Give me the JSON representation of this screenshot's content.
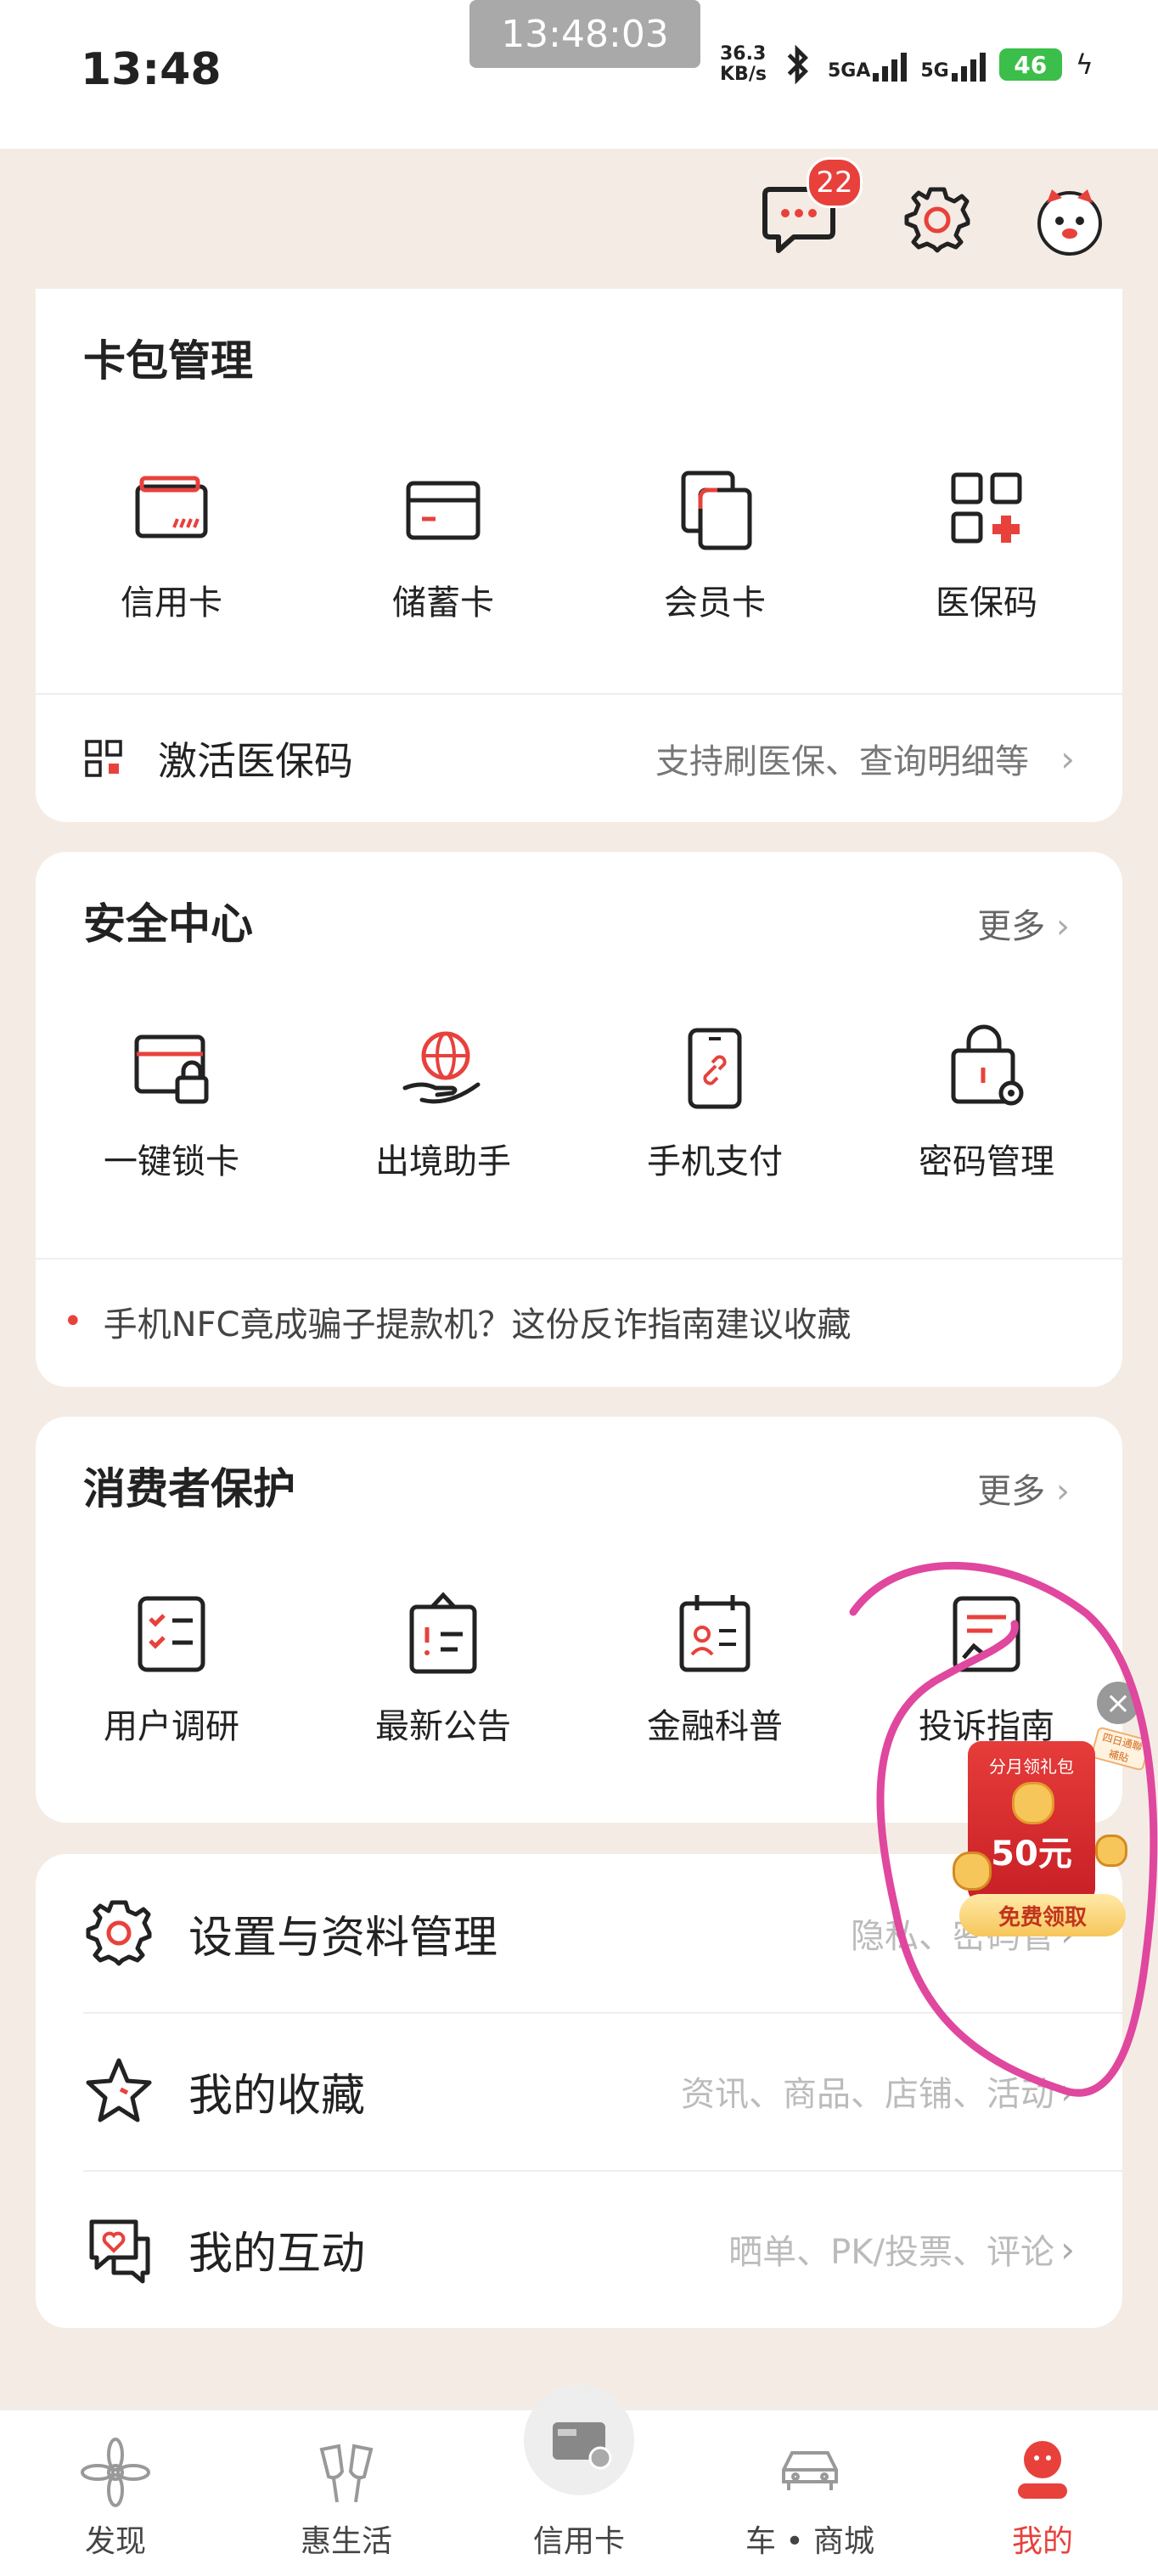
{
  "status_bar": {
    "time": "13:48",
    "overlay_time": "13:48:03",
    "net_speed_value": "36.3",
    "net_speed_unit": "KB/s",
    "signal1": "5GA",
    "signal2": "5G",
    "battery": "46"
  },
  "header": {
    "message_badge": "22"
  },
  "card_wallet": {
    "title": "卡包管理",
    "items": [
      {
        "label": "信用卡",
        "icon": "credit-card-icon"
      },
      {
        "label": "储蓄卡",
        "icon": "debit-card-icon"
      },
      {
        "label": "会员卡",
        "icon": "membership-card-icon"
      },
      {
        "label": "医保码",
        "icon": "medical-qr-icon"
      }
    ],
    "activate": {
      "label": "激活医保码",
      "hint": "支持刷医保、查询明细等"
    }
  },
  "security": {
    "title": "安全中心",
    "more": "更多",
    "items": [
      {
        "label": "一键锁卡",
        "icon": "lock-card-icon"
      },
      {
        "label": "出境助手",
        "icon": "globe-hand-icon"
      },
      {
        "label": "手机支付",
        "icon": "phone-pay-icon"
      },
      {
        "label": "密码管理",
        "icon": "password-lock-icon"
      }
    ],
    "notice": "手机NFC竟成骗子提款机？这份反诈指南建议收藏"
  },
  "consumer": {
    "title": "消费者保护",
    "more": "更多",
    "items": [
      {
        "label": "用户调研",
        "icon": "survey-checklist-icon"
      },
      {
        "label": "最新公告",
        "icon": "announcement-icon"
      },
      {
        "label": "金融科普",
        "icon": "finance-calendar-icon"
      },
      {
        "label": "投诉指南",
        "icon": "complaint-guide-icon"
      }
    ]
  },
  "settings_list": [
    {
      "label": "设置与资料管理",
      "hint": "隐私、密码管",
      "icon": "gear-icon"
    },
    {
      "label": "我的收藏",
      "hint": "资讯、商品、店铺、活动",
      "icon": "star-icon"
    },
    {
      "label": "我的互动",
      "hint": "晒单、PK/投票、评论",
      "icon": "chat-heart-icon"
    }
  ],
  "promo": {
    "top": "分月领礼包",
    "amount": "50元",
    "button": "免费领取",
    "tag": "四日通聯 補貼"
  },
  "tabs": [
    {
      "label": "发现",
      "icon": "discover-icon"
    },
    {
      "label": "惠生活",
      "icon": "cheers-icon"
    },
    {
      "label": "信用卡",
      "icon": "credit-card-tab-icon"
    },
    {
      "label": "车 • 商城",
      "icon": "car-icon"
    },
    {
      "label": "我的",
      "icon": "profile-icon"
    }
  ],
  "colors": {
    "accent": "#e8413c",
    "background": "#f4ece4",
    "annotation": "#e0479e"
  }
}
